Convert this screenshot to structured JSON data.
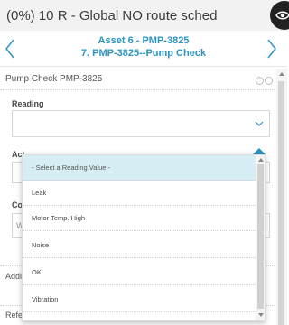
{
  "header": {
    "title": "(0%) 10 R - Global NO route sched"
  },
  "nav": {
    "asset_line": "Asset 6 - PMP-3825",
    "task_line": "7. PMP-3825--Pump Check"
  },
  "section": {
    "title": "Pump Check PMP-3825"
  },
  "reading": {
    "label": "Reading"
  },
  "background_fields": {
    "action_label_partial": "Act",
    "comment_label_partial": "Co",
    "comment_placeholder_partial": "W",
    "additional_partial": "Addi",
    "reference_partial": "Reference Documents"
  },
  "dropdown": {
    "options": [
      "- Select a Reading Value -",
      "Leak",
      "Motor Temp. High",
      "Noise",
      "OK",
      "Vibration"
    ],
    "selected_index": 0
  },
  "colors": {
    "accent": "#2b94c2",
    "selected_bg": "#d6edf4"
  },
  "icons": [
    "eye-icon",
    "chevron-left-icon",
    "chevron-right-icon",
    "chevron-down-icon"
  ]
}
